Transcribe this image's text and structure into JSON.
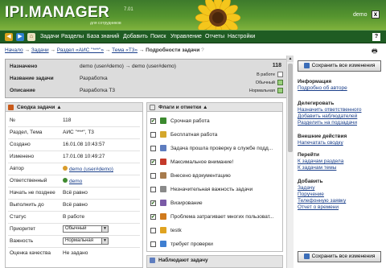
{
  "header": {
    "logo": "IPI.MANAGER",
    "logo_sub": "для сотрудников",
    "version": "7.01",
    "user": "demo",
    "close": "x"
  },
  "menu": {
    "items": [
      "Задачи",
      "Разделы",
      "База знаний",
      "Добавить",
      "Поиск",
      "Управление",
      "Отчеты",
      "Настройки"
    ],
    "help": "?"
  },
  "breadcrumbs": {
    "items": [
      "Начало",
      "Задачи",
      "Раздел «АИС \"***\"»",
      "Тема «Т3»",
      "Подробности задачи"
    ],
    "sep": "→"
  },
  "task_info": {
    "assigned_label": "Назначено",
    "assigned_value": "demo (user#demo) → demo (user#demo)",
    "name_label": "Название задачи",
    "name_value": "Разработка",
    "desc_label": "Описание",
    "desc_value": "Разработка Т3",
    "id": "118",
    "status_in_work": "В работе",
    "status_normal": "Обычный",
    "status_normal2": "Нормальная"
  },
  "summary": {
    "title": "Сводка задачи",
    "rows": [
      {
        "k": "№",
        "v": "118"
      },
      {
        "k": "Раздел, Тема",
        "v": "АИС \"***\", Т3"
      },
      {
        "k": "Создано",
        "v": "16.01.08 10:43:57"
      },
      {
        "k": "Изменено",
        "v": "17.01.08 10:49:27"
      },
      {
        "k": "Автор",
        "v": "demo (user#demo)"
      },
      {
        "k": "Ответственный",
        "v": "demo"
      },
      {
        "k": "Начать не позднее",
        "v": "Всё равно"
      },
      {
        "k": "Выполнить до",
        "v": "Всё равно"
      },
      {
        "k": "Статус",
        "v": "В работе"
      },
      {
        "k": "Приоритет",
        "v": "Обычный"
      },
      {
        "k": "Важность",
        "v": "Нормальная"
      },
      {
        "k": "Оценка качества",
        "v": "Не задано"
      }
    ]
  },
  "flags": {
    "title": "Флаги и отметки",
    "items": [
      {
        "label": "Срочная работа",
        "checked": true,
        "color": "#3c8a2f"
      },
      {
        "label": "Бесплатная работа",
        "checked": false,
        "color": "#d4a72c"
      },
      {
        "label": "Задача прошла проверку в службе подд...",
        "checked": false,
        "color": "#5e7dbf"
      },
      {
        "label": "Максимальное внимание!",
        "checked": true,
        "color": "#c43a2a"
      },
      {
        "label": "Внесено вдокументацию",
        "checked": false,
        "color": "#a77b4d"
      },
      {
        "label": "Незначительная важность задачи",
        "checked": false,
        "color": "#8a8a8a"
      },
      {
        "label": "Визирование",
        "checked": true,
        "color": "#7a5aa6"
      },
      {
        "label": "Проблема затрагивает многих пользоват...",
        "checked": true,
        "color": "#d07a1c"
      },
      {
        "label": "testk",
        "checked": false,
        "color": "#e0a320"
      },
      {
        "label": "требует проверки",
        "checked": false,
        "color": "#3f7fd1"
      }
    ]
  },
  "watchers": {
    "title": "Наблюдают задачу"
  },
  "sidebar": {
    "save_label": "Сохранить все изменения",
    "sections": [
      {
        "title": "Информация",
        "links": [
          "Подробно об авторе"
        ]
      },
      {
        "title": "Делегировать",
        "links": [
          "Назначить ответственного",
          "Добавить наблюдателей",
          "Разделить на подзадачи"
        ]
      },
      {
        "title": "Внешние действия",
        "links": [
          "Напечатать сводку"
        ]
      },
      {
        "title": "Перейти",
        "links": [
          "К задачам раздела",
          "К задачам темы"
        ]
      },
      {
        "title": "Добавить",
        "links": [
          "Задачу",
          "Поручение",
          "Телефонную заявку",
          "Отчет о времени"
        ]
      }
    ]
  }
}
